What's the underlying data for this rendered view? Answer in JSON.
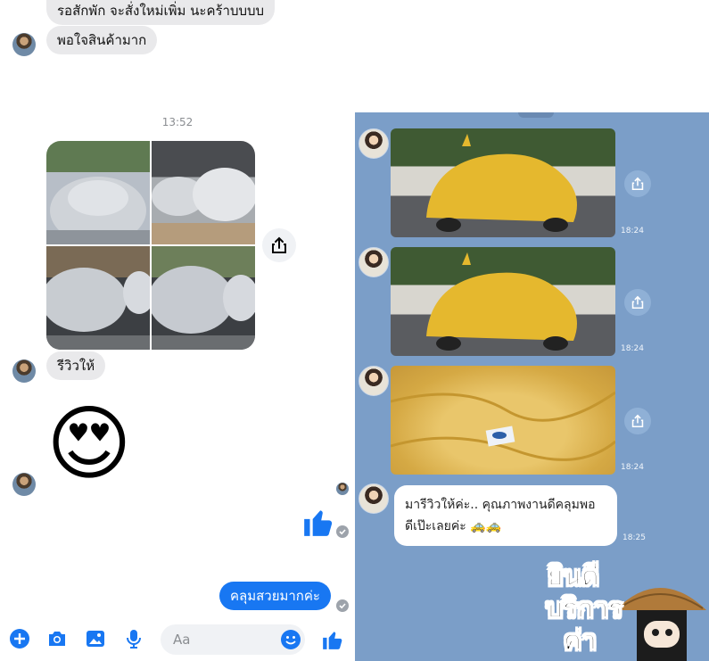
{
  "messenger": {
    "messages": [
      {
        "text": "รอสักพัก จะสั่งใหม่เพิ่ม นะคร้าบบบบ"
      },
      {
        "text": "พอใจสินค้ามาก"
      }
    ],
    "timestamp": "13:52",
    "review_text": "รีวิวให้",
    "sticker_emoji": "😍",
    "reply_text": "คลุมสวยมากค่ะ",
    "composer_placeholder": "Aa",
    "accent_color": "#1877f2"
  },
  "line_chat": {
    "photos": [
      {
        "time": "18:24"
      },
      {
        "time": "18:24"
      },
      {
        "time": "18:24"
      }
    ],
    "bubble_line1": "มารีวิวให้ค่ะ.. คุณภาพงานดีคลุมพอ",
    "bubble_line2": "ดีเป๊ะเลยค่ะ",
    "bubble_emoji": "🚕🚕",
    "bubble_time": "18:25",
    "sticker": {
      "word1": "ยินดี",
      "word2": "บริการ",
      "word3": "ค่า"
    }
  }
}
